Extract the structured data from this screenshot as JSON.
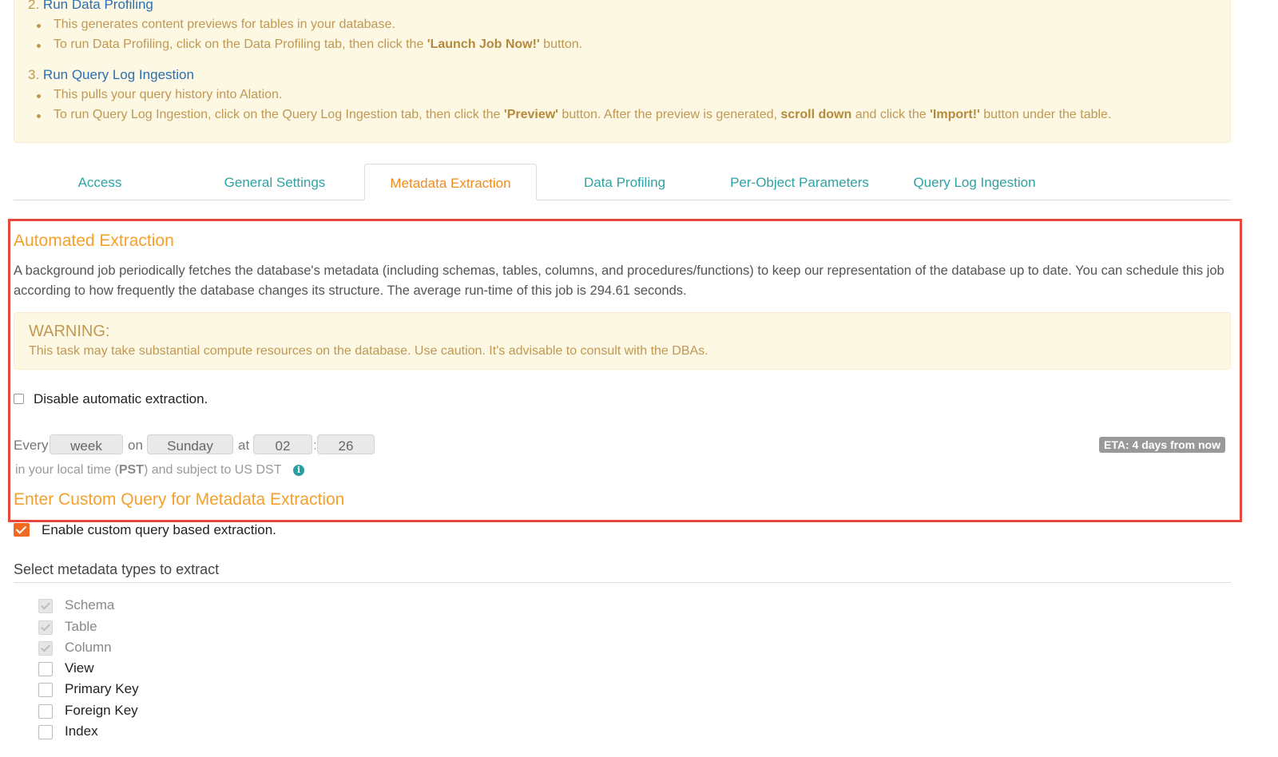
{
  "banner": {
    "step2": {
      "number": "2.",
      "title": "Run Data Profiling",
      "b1": "This generates content previews for tables in your database.",
      "b2_pre": "To run Data Profiling, click on the Data Profiling tab, then click the ",
      "b2_bold": "'Launch Job Now!'",
      "b2_post": " button."
    },
    "step3": {
      "number": "3.",
      "title": "Run Query Log Ingestion",
      "b1": "This pulls your query history into Alation.",
      "b2_pre": "To run Query Log Ingestion, click on the Query Log Ingestion tab, then click the ",
      "b2_bold1": "'Preview'",
      "b2_mid1": " button. After the preview is generated, ",
      "b2_bold2": "scroll down",
      "b2_mid2": " and click the ",
      "b2_bold3": "'Import!'",
      "b2_post": " button under the table."
    }
  },
  "tabs": {
    "access": "Access",
    "general": "General Settings",
    "metadata": "Metadata Extraction",
    "profiling": "Data Profiling",
    "perobject": "Per-Object Parameters",
    "querylog": "Query Log Ingestion",
    "active": "metadata"
  },
  "automated": {
    "title": "Automated Extraction",
    "description": "A background job periodically fetches the database's metadata (including schemas, tables, columns, and procedures/functions) to keep our representation of the database up to date. You can schedule this job according to how frequently the database changes its structure. The average run-time of this job is 294.61 seconds.",
    "warning_title": "WARNING:",
    "warning_text": "This task may take substantial compute resources on the database. Use caution. It's advisable to consult with the DBAs.",
    "disable_label": "Disable automatic extraction.",
    "disable_checked": false
  },
  "schedule": {
    "every": "Every",
    "period": "week",
    "on": "on",
    "day": "Sunday",
    "at": "at",
    "hour": "02",
    "colon": ":",
    "minute": "26",
    "eta": "ETA: 4 days from now",
    "tz_pre": "in your local time (",
    "tz": "PST",
    "tz_post": ") and subject to US DST",
    "info_glyph": "i"
  },
  "custom_query": {
    "title": "Enter Custom Query for Metadata Extraction",
    "enable_label": "Enable custom query based extraction.",
    "enable_checked": true
  },
  "metadata_types": {
    "title": "Select metadata types to extract",
    "items": [
      {
        "label": "Schema",
        "checked": true,
        "disabled": true
      },
      {
        "label": "Table",
        "checked": true,
        "disabled": true
      },
      {
        "label": "Column",
        "checked": true,
        "disabled": true
      },
      {
        "label": "View",
        "checked": false,
        "disabled": false
      },
      {
        "label": "Primary Key",
        "checked": false,
        "disabled": false
      },
      {
        "label": "Foreign Key",
        "checked": false,
        "disabled": false
      },
      {
        "label": "Index",
        "checked": false,
        "disabled": false
      }
    ]
  },
  "colors": {
    "accent_orange": "#f5a02c",
    "tab_teal": "#2fa3a3",
    "highlight_red": "#e8473f",
    "checkbox_orange": "#f26a21"
  }
}
